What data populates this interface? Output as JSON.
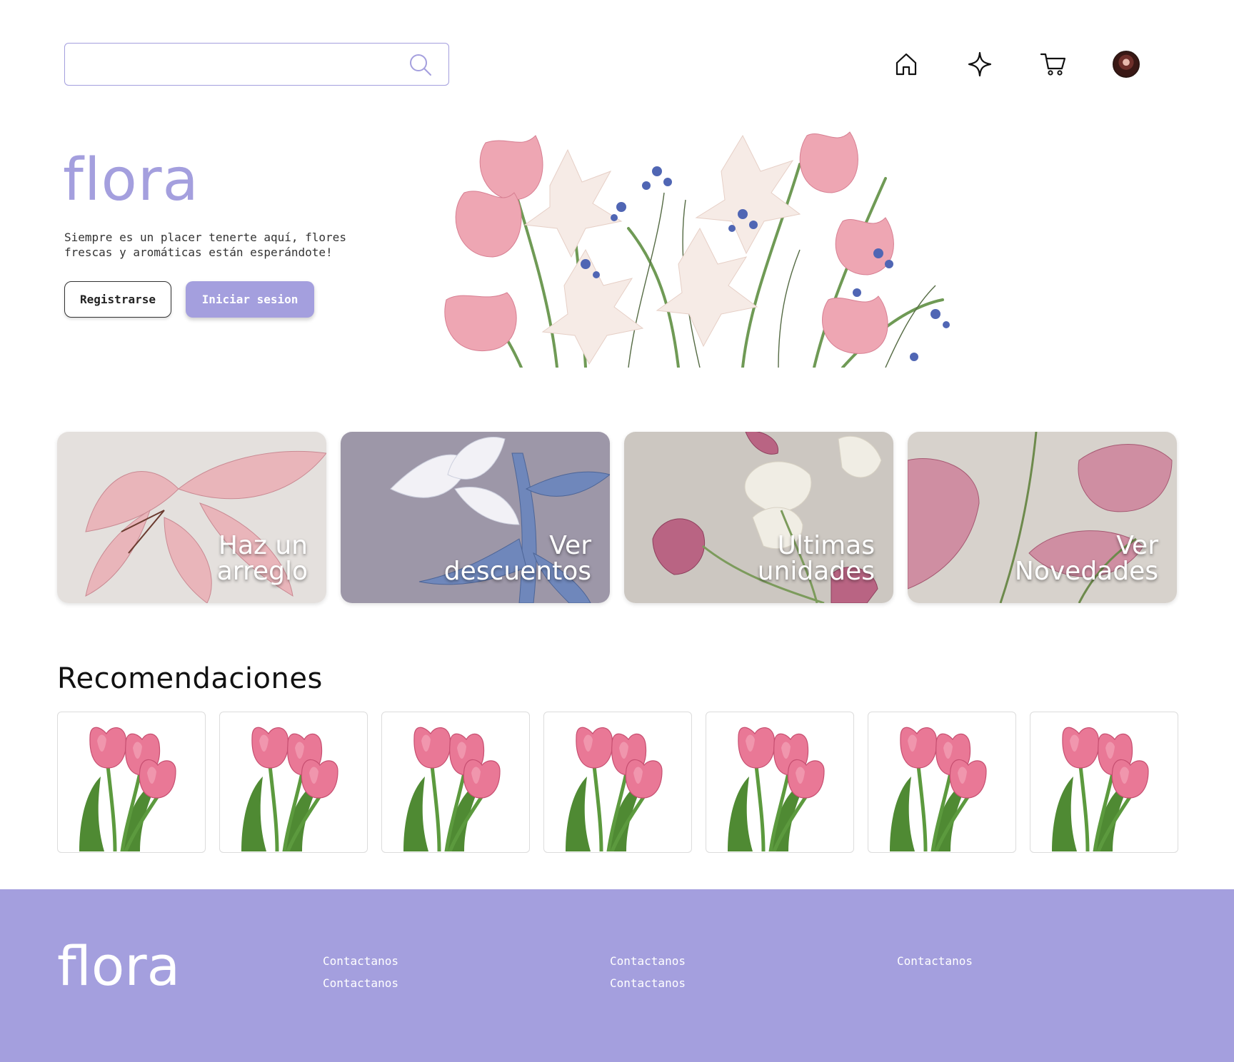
{
  "header": {
    "search": {
      "value": "",
      "placeholder": ""
    },
    "icons": [
      "home-icon",
      "sparkle-icon",
      "cart-icon",
      "avatar"
    ]
  },
  "hero": {
    "title": "flora",
    "tagline": "Siempre es un placer tenerte aquí, flores frescas y aromáticas están esperándote!",
    "register_label": "Registrarse",
    "login_label": "Iniciar sesion"
  },
  "categories": [
    {
      "label": "Haz un\narreglo"
    },
    {
      "label": "Ver\ndescuentos"
    },
    {
      "label": "Ultimas\nunidades"
    },
    {
      "label": "Ver\nNovedades"
    }
  ],
  "recommendations": {
    "title": "Recomendaciones",
    "count_visible": 7
  },
  "footer": {
    "brand": "flora",
    "columns": [
      [
        "Contactanos",
        "Contactanos"
      ],
      [
        "Contactanos",
        "Contactanos"
      ],
      [
        "Contactanos"
      ]
    ]
  },
  "colors": {
    "accent": "#a49fde",
    "footer_bg": "#a49fde",
    "text": "#111111"
  }
}
